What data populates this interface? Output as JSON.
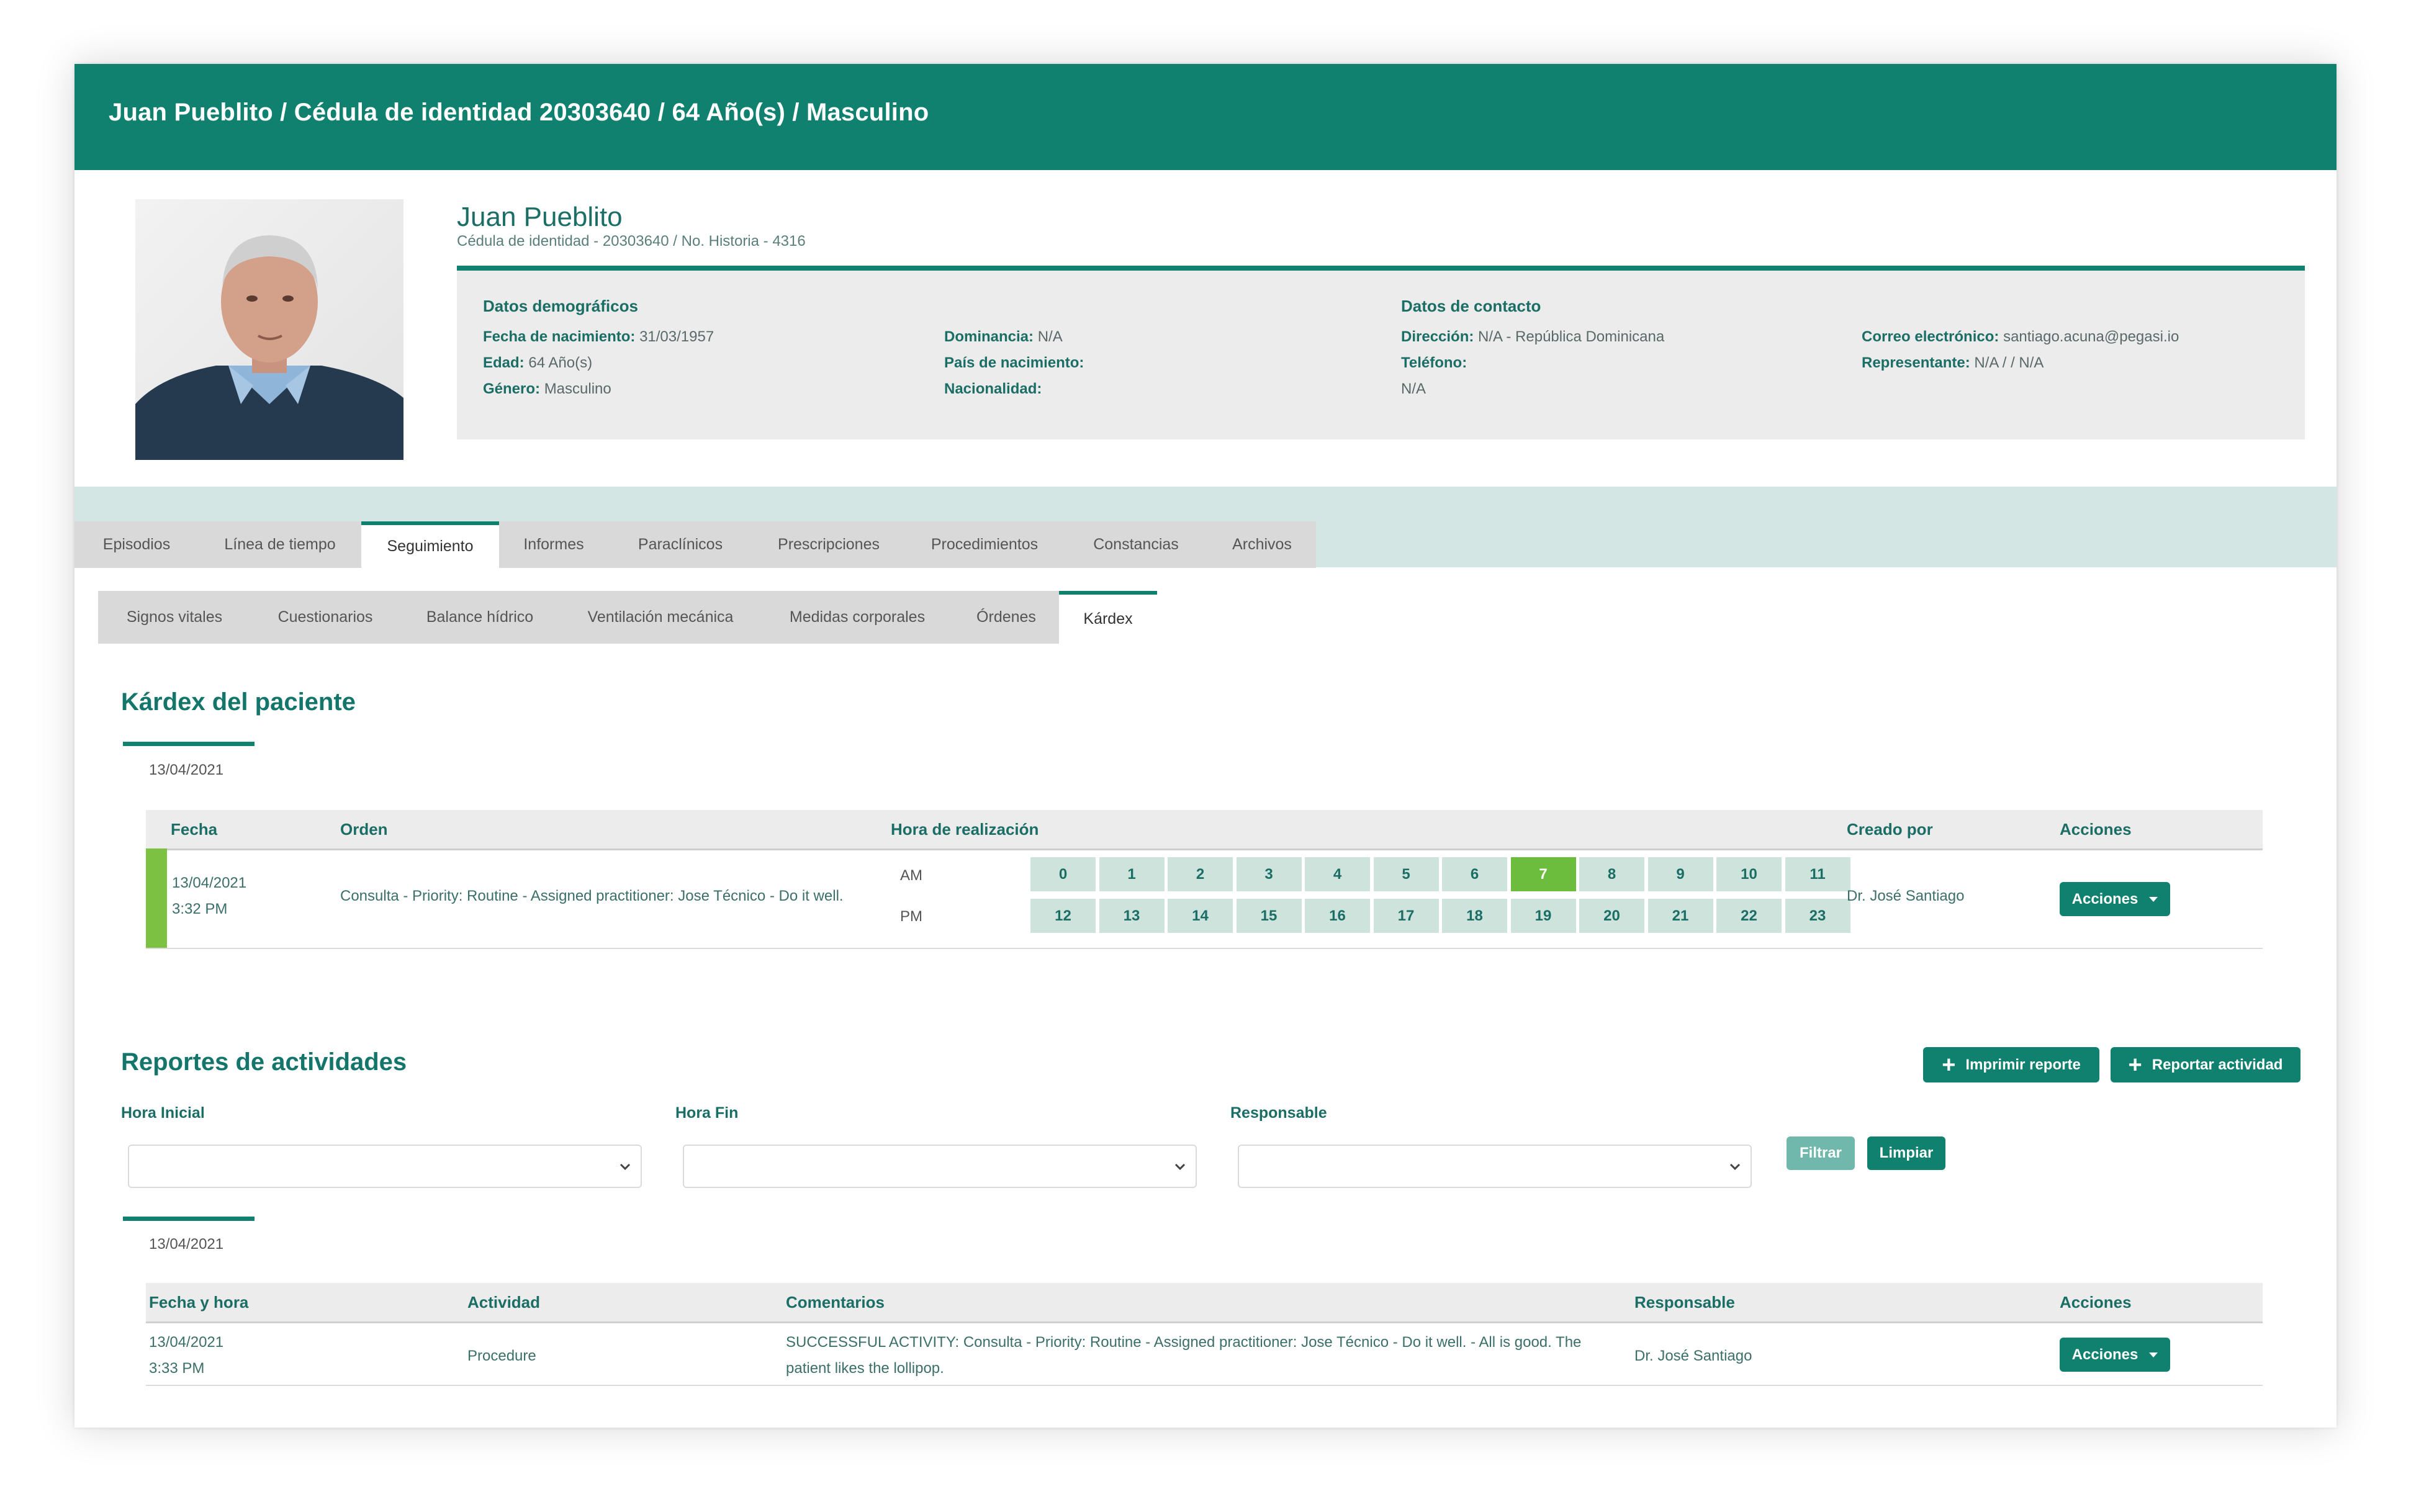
{
  "header": {
    "title": "Juan Pueblito / Cédula de identidad 20303640 / 64 Año(s) / Masculino"
  },
  "patient": {
    "name": "Juan Pueblito",
    "subtitle": "Cédula de identidad - 20303640 / No. Historia - 4316",
    "photo": "patient-photo"
  },
  "demographics": {
    "title": "Datos demográficos",
    "birth_label": "Fecha de nacimiento:",
    "birth_value": "31/03/1957",
    "age_label": "Edad:",
    "age_value": "64 Año(s)",
    "gender_label": "Género:",
    "gender_value": "Masculino",
    "dominance_label": "Dominancia:",
    "dominance_value": "N/A",
    "country_label": "País de nacimiento:",
    "country_value": "",
    "nationality_label": "Nacionalidad:",
    "nationality_value": ""
  },
  "contact": {
    "title": "Datos de contacto",
    "address_label": "Dirección:",
    "address_value": "N/A - República Dominicana",
    "phone_label": "Teléfono:",
    "phone_value": "N/A",
    "email_label": "Correo electrónico:",
    "email_value": "santiago.acuna@pegasi.io",
    "rep_label": "Representante:",
    "rep_value": "N/A / / N/A"
  },
  "main_tabs": [
    "Episodios",
    "Línea de tiempo",
    "Seguimiento",
    "Informes",
    "Paraclínicos",
    "Prescripciones",
    "Procedimientos",
    "Constancias",
    "Archivos"
  ],
  "main_tabs_active": "Seguimiento",
  "sub_tabs": [
    "Signos vitales",
    "Cuestionarios",
    "Balance hídrico",
    "Ventilación mecánica",
    "Medidas corporales",
    "Órdenes",
    "Kárdex"
  ],
  "sub_tabs_active": "Kárdex",
  "kardex": {
    "title": "Kárdex del paciente",
    "date": "13/04/2021",
    "columns": {
      "fecha": "Fecha",
      "orden": "Orden",
      "hora": "Hora de realización",
      "creado": "Creado por",
      "acciones": "Acciones"
    },
    "row": {
      "date": "13/04/2021",
      "time": "3:32 PM",
      "order": "Consulta - Priority: Routine - Assigned practitioner: Jose Técnico - Do it well.",
      "created_by": "Dr. José Santiago",
      "actions_label": "Acciones",
      "am_label": "AM",
      "pm_label": "PM",
      "am_hours": [
        "0",
        "1",
        "2",
        "3",
        "4",
        "5",
        "6",
        "7",
        "8",
        "9",
        "10",
        "11"
      ],
      "pm_hours": [
        "12",
        "13",
        "14",
        "15",
        "16",
        "17",
        "18",
        "19",
        "20",
        "21",
        "22",
        "23"
      ],
      "done_hour": "7",
      "status_color": "#7cc142"
    }
  },
  "reports": {
    "title": "Reportes de actividades",
    "print_button": "Imprimir reporte",
    "report_button": "Reportar actividad",
    "filters": {
      "start_label": "Hora Inicial",
      "start_value": "",
      "end_label": "Hora Fin",
      "end_value": "",
      "responsible_label": "Responsable",
      "responsible_value": "",
      "filter_button": "Filtrar",
      "clear_button": "Limpiar"
    },
    "date": "13/04/2021",
    "columns": {
      "fecha": "Fecha y hora",
      "actividad": "Actividad",
      "comentarios": "Comentarios",
      "responsable": "Responsable",
      "acciones": "Acciones"
    },
    "row": {
      "date": "13/04/2021",
      "time": "3:33 PM",
      "activity": "Procedure",
      "comment_line1": "SUCCESSFUL ACTIVITY: Consulta - Priority: Routine - Assigned practitioner: Jose Técnico - Do it well. - All is good. The",
      "comment_line2": "patient likes the lollipop.",
      "responsible": "Dr. José Santiago",
      "actions_label": "Acciones"
    }
  },
  "colors": {
    "primary": "#10806f",
    "tab_band": "#d4e6e3",
    "hour_cell": "#cde3dc",
    "hour_done": "#6cbd3d"
  }
}
